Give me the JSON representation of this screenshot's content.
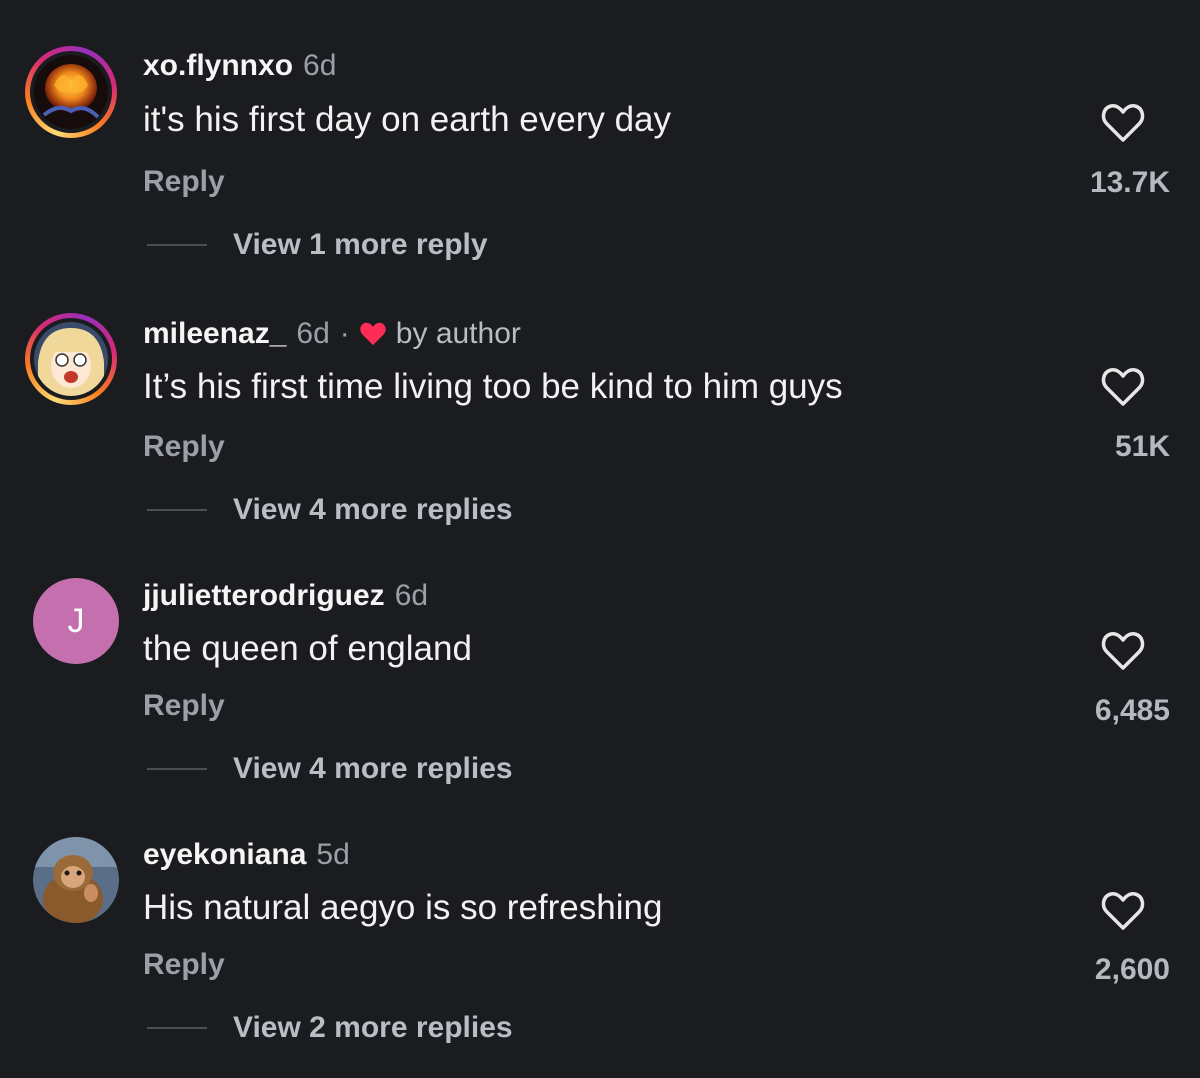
{
  "colors": {
    "background": "#1b1c20",
    "primary_text": "#f5f5f5",
    "secondary_text": "#9ba0a8",
    "author_heart": "#ff2d55",
    "letter_avatar": "#c46fae"
  },
  "comments": [
    {
      "username": "xo.flynnxo",
      "time": "6d",
      "text": "it's his first day on earth every day",
      "reply_label": "Reply",
      "likes": "13.7K",
      "view_more": "View 1 more reply",
      "avatar": {
        "type": "image",
        "icon": "fire-butterfly-avatar",
        "story_ring": true
      }
    },
    {
      "username": "mileenaz_",
      "time": "6d",
      "separator": "·",
      "liked_by_author": "by author",
      "text": "It’s his first time living too be kind to him guys",
      "reply_label": "Reply",
      "likes": "51K",
      "view_more": "View 4 more replies",
      "avatar": {
        "type": "image",
        "icon": "anime-girl-avatar",
        "story_ring": true
      }
    },
    {
      "username": "jjulietterodriguez",
      "time": "6d",
      "text": "the queen of england",
      "reply_label": "Reply",
      "likes": "6,485",
      "view_more": "View 4 more replies",
      "avatar": {
        "type": "letter",
        "letter": "J",
        "story_ring": false
      }
    },
    {
      "username": "eyekoniana",
      "time": "5d",
      "text": "His natural aegyo is so refreshing",
      "reply_label": "Reply",
      "likes": "2,600",
      "view_more": "View 2 more replies",
      "avatar": {
        "type": "image",
        "icon": "monkey-avatar",
        "story_ring": false
      }
    }
  ]
}
